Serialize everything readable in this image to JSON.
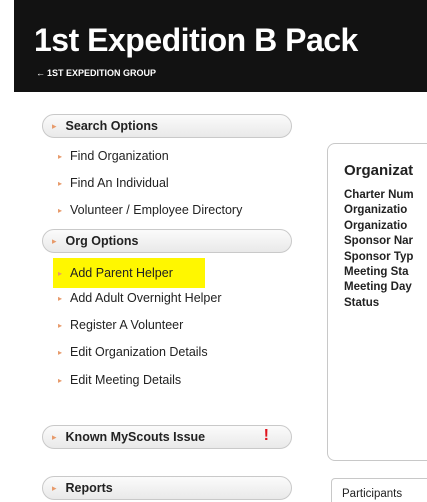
{
  "header": {
    "title": "1st Expedition B Pack",
    "back_link": "1ST EXPEDITION GROUP",
    "back_arrow": "←"
  },
  "sidebar": {
    "bullet": "▸",
    "search_options": {
      "label": "Search Options",
      "items": [
        "Find Organization",
        "Find An Individual",
        "Volunteer / Employee Directory"
      ]
    },
    "org_options": {
      "label": "Org Options",
      "items": [
        "Add Parent Helper",
        "Add Adult Overnight Helper",
        "Register A Volunteer",
        "Edit Organization Details",
        "Edit Meeting Details"
      ]
    },
    "known_issue": {
      "label": "Known MyScouts Issue",
      "alert": "!"
    },
    "reports": {
      "label": "Reports"
    }
  },
  "org_panel": {
    "title": "Organizat",
    "fields": [
      "Charter Num",
      "Organizatio",
      "Organizatio",
      "Sponsor Nar",
      "Sponsor Typ",
      "Meeting Sta",
      "Meeting Day",
      "Status"
    ]
  },
  "tabs": {
    "participants": "Participants"
  },
  "colors": {
    "header_bg": "#121212",
    "highlight": "#fff700",
    "bullet": "#e79a6a",
    "alert": "#e0141e"
  }
}
